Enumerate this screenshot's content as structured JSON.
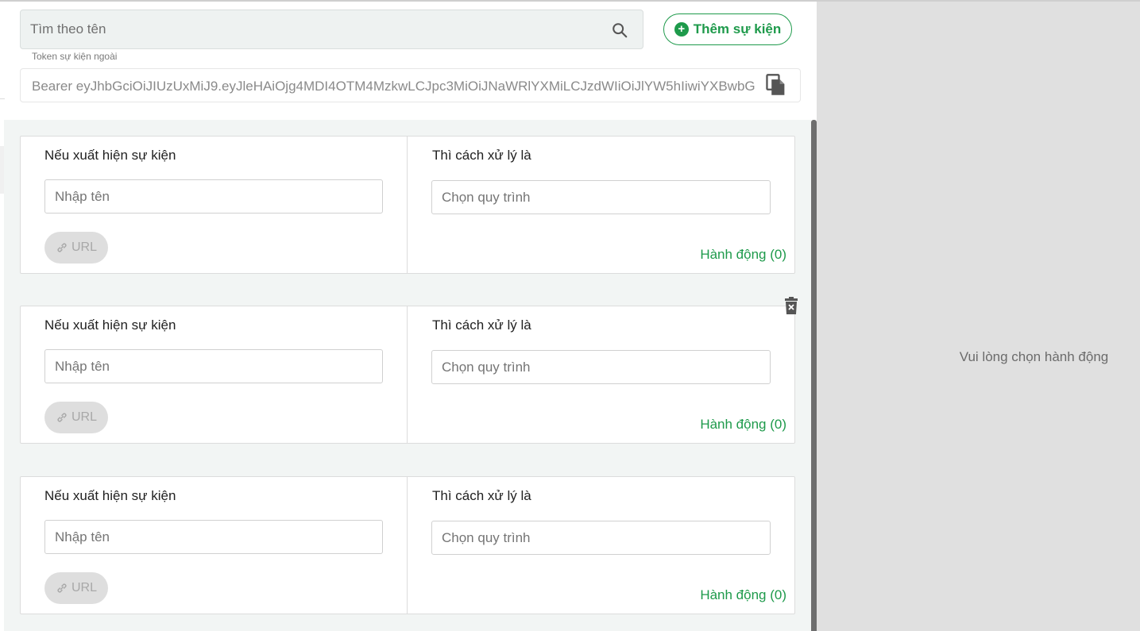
{
  "search": {
    "placeholder": "Tìm theo tên"
  },
  "add_button": {
    "label": "Thêm sự kiện"
  },
  "token": {
    "label": "Token sự kiện ngoài",
    "value": "Bearer eyJhbGciOiJIUzUxMiJ9.eyJleHAiOjg4MDI4OTM4MzkwLCJpc3MiOiJNaWRlYXMiLCJzdWIiOiJlYW5hIiwiYXBwbG"
  },
  "events": [
    {
      "event_label": "Nếu xuất hiện sự kiện",
      "name_placeholder": "Nhập tên",
      "url_label": "URL",
      "handler_label": "Thì cách xử lý là",
      "process_placeholder": "Chọn quy trình",
      "action_label": "Hành động (0)"
    },
    {
      "event_label": "Nếu xuất hiện sự kiện",
      "name_placeholder": "Nhập tên",
      "url_label": "URL",
      "handler_label": "Thì cách xử lý là",
      "process_placeholder": "Chọn quy trình",
      "action_label": "Hành động (0)"
    },
    {
      "event_label": "Nếu xuất hiện sự kiện",
      "name_placeholder": "Nhập tên",
      "url_label": "URL",
      "handler_label": "Thì cách xử lý là",
      "process_placeholder": "Chọn quy trình",
      "action_label": "Hành động (0)"
    }
  ],
  "detail_panel": {
    "empty_message": "Vui lòng chọn hành động"
  },
  "icons": {
    "search": "search-icon",
    "add": "plus-circle-icon",
    "copy": "copy-icon",
    "link": "link-icon",
    "delete": "trash-icon"
  },
  "colors": {
    "accent": "#1e9a4b",
    "panel_bg": "#e0e0e0",
    "list_bg": "#f2f5f4"
  }
}
